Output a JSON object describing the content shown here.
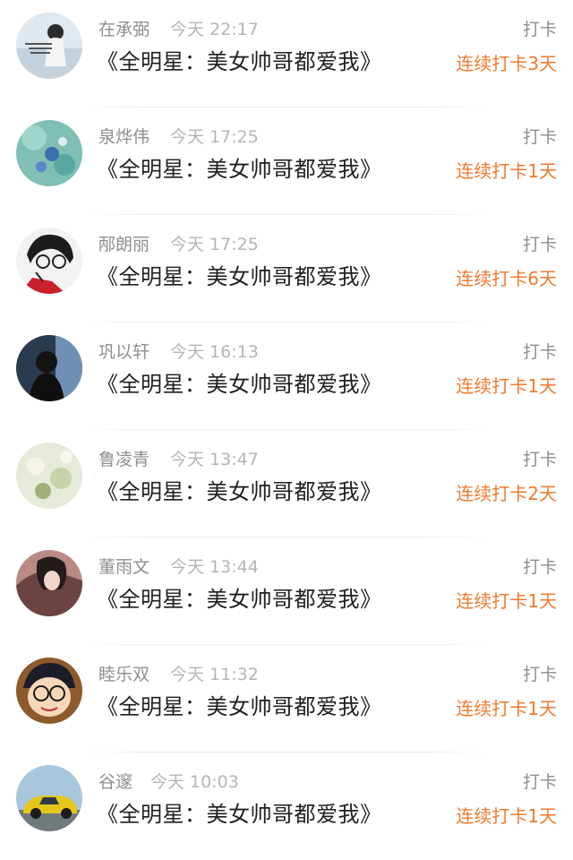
{
  "entries": [
    {
      "name": "在承弼",
      "time": "今天 22:17",
      "title": "《全明星：美女帅哥都爱我》",
      "action": "打卡",
      "streak": "连续打卡3天",
      "avatar": "avatar-girl-text-photo"
    },
    {
      "name": "泉烨伟",
      "time": "今天 17:25",
      "title": "《全明星：美女帅哥都爱我》",
      "action": "打卡",
      "streak": "连续打卡1天",
      "avatar": "avatar-blue-flowers"
    },
    {
      "name": "邴朗丽",
      "time": "今天 17:25",
      "title": "《全明星：美女帅哥都爱我》",
      "action": "打卡",
      "streak": "连续打卡6天",
      "avatar": "avatar-manga-boy-glasses"
    },
    {
      "name": "巩以轩",
      "time": "今天 16:13",
      "title": "《全明星：美女帅哥都爱我》",
      "action": "打卡",
      "streak": "连续打卡1天",
      "avatar": "avatar-dark-portrait"
    },
    {
      "name": "鲁凌青",
      "time": "今天 13:47",
      "title": "《全明星：美女帅哥都爱我》",
      "action": "打卡",
      "streak": "连续打卡2天",
      "avatar": "avatar-pale-flowers"
    },
    {
      "name": "董雨文",
      "time": "今天 13:44",
      "title": "《全明星：美女帅哥都爱我》",
      "action": "打卡",
      "streak": "连续打卡1天",
      "avatar": "avatar-anime-character"
    },
    {
      "name": "睦乐双",
      "time": "今天 11:32",
      "title": "《全明星：美女帅哥都爱我》",
      "action": "打卡",
      "streak": "连续打卡1天",
      "avatar": "avatar-cartoon-boy"
    },
    {
      "name": "谷邃",
      "time": "今天 10:03",
      "title": "《全明星：美女帅哥都爱我》",
      "action": "打卡",
      "streak": "连续打卡1天",
      "avatar": "avatar-yellow-car"
    }
  ]
}
